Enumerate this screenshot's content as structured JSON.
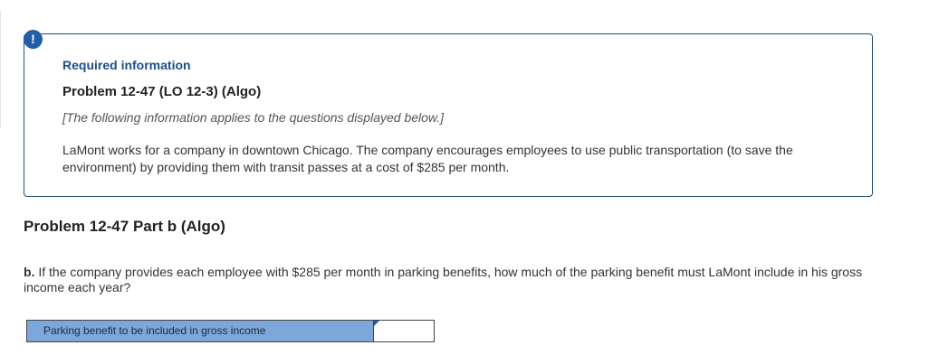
{
  "alert": {
    "icon": "exclamation-icon",
    "symbol": "!",
    "color": "#1f5fa8"
  },
  "info_box": {
    "heading": "Required information",
    "problem_title": "Problem 12-47 (LO 12-3) (Algo)",
    "applies_note": "[The following information applies to the questions displayed below.]",
    "scenario": "LaMont works for a company in downtown Chicago. The company encourages employees to use public transportation (to save the environment) by providing them with transit passes at a cost of $285 per month."
  },
  "part": {
    "heading": "Problem 12-47 Part b (Algo)",
    "question_letter": "b.",
    "question_text": " If the company provides each employee with $285 per month in parking benefits, how much of the parking benefit must LaMont include in his gross income each year?"
  },
  "answer": {
    "label": "Parking benefit to be included in gross income",
    "value": ""
  },
  "colors": {
    "accent": "#1f5fa8",
    "heading_blue": "#1b4f8a",
    "label_fill": "#7da7da",
    "box_border": "#1f4e79"
  }
}
